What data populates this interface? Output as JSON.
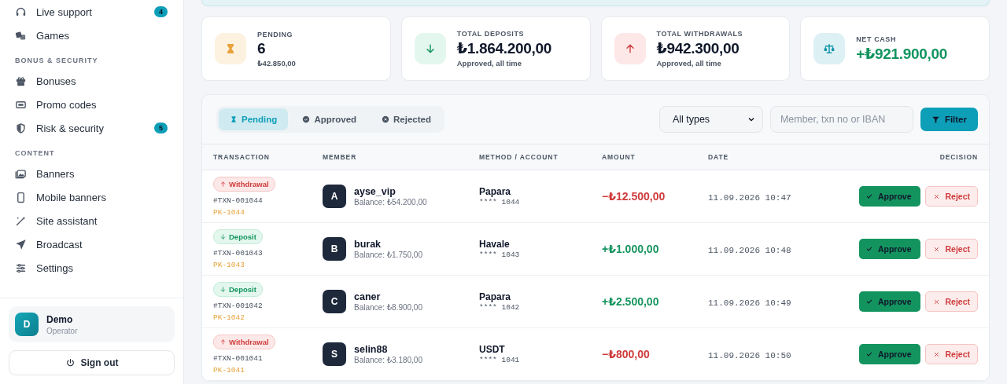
{
  "sidebar": {
    "sections": [
      {
        "items": [
          {
            "label": "Live support",
            "count": "4"
          },
          {
            "label": "Games"
          }
        ]
      },
      {
        "heading": "BONUS & SECURITY",
        "items": [
          {
            "label": "Bonuses"
          },
          {
            "label": "Promo codes"
          },
          {
            "label": "Risk & security",
            "count": "5"
          }
        ]
      },
      {
        "heading": "CONTENT",
        "items": [
          {
            "label": "Banners"
          },
          {
            "label": "Mobile banners"
          },
          {
            "label": "Site assistant"
          },
          {
            "label": "Broadcast"
          },
          {
            "label": "Settings"
          }
        ]
      }
    ],
    "user": {
      "initial": "D",
      "name": "Demo",
      "role": "Operator"
    },
    "sign_out": "Sign out"
  },
  "stats": [
    {
      "kind": "pending",
      "label": "PENDING",
      "value": "6",
      "note": "₺42.850,00"
    },
    {
      "kind": "deposits",
      "label": "TOTAL DEPOSITS",
      "value": "₺1.864.200,00",
      "note": "Approved, all time"
    },
    {
      "kind": "withdrawals",
      "label": "TOTAL WITHDRAWALS",
      "value": "₺942.300,00",
      "note": "Approved, all time"
    },
    {
      "kind": "net",
      "label": "NET CASH",
      "value": "+₺921.900,00"
    }
  ],
  "panel": {
    "tabs": [
      {
        "kind": "pending",
        "label": "Pending",
        "selected": true
      },
      {
        "kind": "approved",
        "label": "Approved",
        "selected": false
      },
      {
        "kind": "rejected",
        "label": "Rejected",
        "selected": false
      }
    ],
    "type_select": {
      "value": "All types"
    },
    "search": {
      "placeholder": "Member, txn no or IBAN"
    },
    "filter_button": "Filter",
    "columns": [
      "TRANSACTION",
      "MEMBER",
      "METHOD / ACCOUNT",
      "AMOUNT",
      "DATE",
      "DECISION"
    ],
    "rows": [
      {
        "kind": "withdrawal",
        "type_label": "Withdrawal",
        "txn_no": "#TXN-001044",
        "ref": "PK-1044",
        "initial": "A",
        "member": "ayse_vip",
        "balance": "Balance: ₺54.200,00",
        "method": "Papara",
        "account": "**** 1044",
        "amount": "−₺12.500,00",
        "date": "11.09.2026 10:47",
        "approve": "Approve",
        "reject": "Reject"
      },
      {
        "kind": "deposit",
        "type_label": "Deposit",
        "txn_no": "#TXN-001043",
        "ref": "PK-1043",
        "initial": "B",
        "member": "burak",
        "balance": "Balance: ₺1.750,00",
        "method": "Havale",
        "account": "**** 1043",
        "amount": "+₺1.000,00",
        "date": "11.09.2026 10:48",
        "approve": "Approve",
        "reject": "Reject"
      },
      {
        "kind": "deposit",
        "type_label": "Deposit",
        "txn_no": "#TXN-001042",
        "ref": "PK-1042",
        "initial": "C",
        "member": "caner",
        "balance": "Balance: ₺8.900,00",
        "method": "Papara",
        "account": "**** 1042",
        "amount": "+₺2.500,00",
        "date": "11.09.2026 10:49",
        "approve": "Approve",
        "reject": "Reject"
      },
      {
        "kind": "withdrawal",
        "type_label": "Withdrawal",
        "txn_no": "#TXN-001041",
        "ref": "PK-1041",
        "initial": "S",
        "member": "selin88",
        "balance": "Balance: ₺3.180,00",
        "method": "USDT",
        "account": "**** 1041",
        "amount": "−₺800,00",
        "date": "11.09.2026 10:50",
        "approve": "Approve",
        "reject": "Reject"
      }
    ]
  }
}
